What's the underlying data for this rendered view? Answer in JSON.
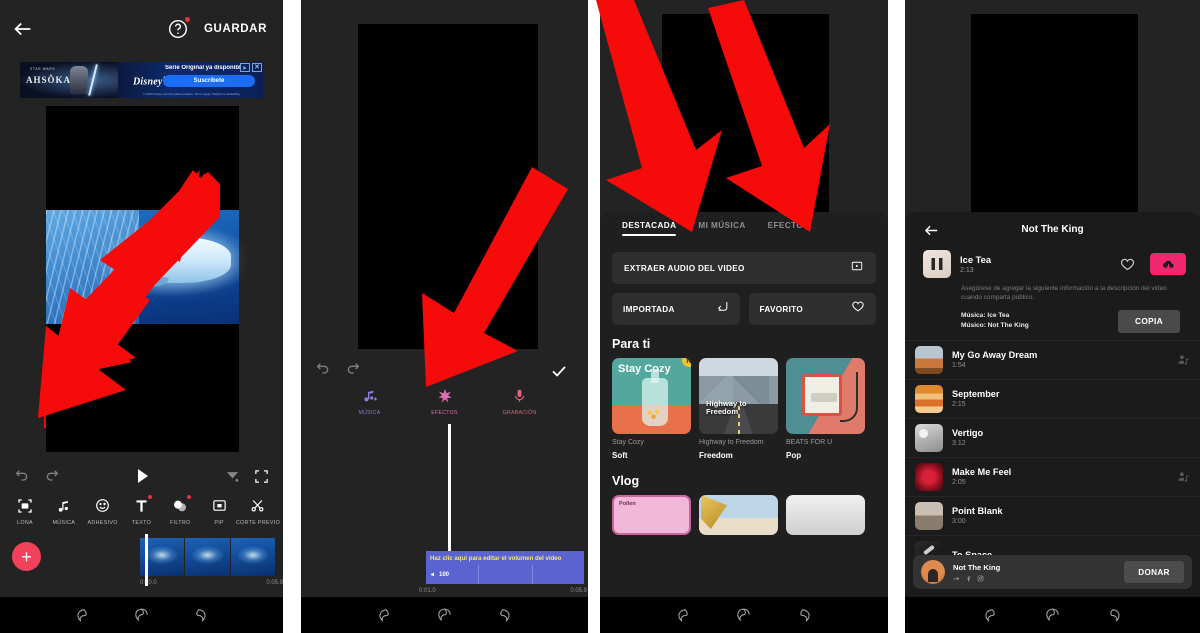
{
  "panel1": {
    "header": {
      "back_icon": "arrow-left-icon",
      "help_icon": "help-circle-icon",
      "save_label": "GUARDAR"
    },
    "ad": {
      "pre_title": "STAR WARS",
      "title": "AHSÔKA",
      "brand": "Disney",
      "brand_plus": "+",
      "headline": "Serie Original ya disponible",
      "cta": "Suscríbete",
      "fine_print": "© 2023 Disney and its related entities. Terms apply. Subject to availability.",
      "ad_badge": "ad-choices-icon",
      "close": "✕"
    },
    "controls": {
      "undo_icon": "undo-icon",
      "redo_icon": "redo-icon",
      "play_icon": "play-icon",
      "ratio_icon": "ratio-icon",
      "expand_icon": "expand-icon"
    },
    "tools": [
      {
        "label": "LONA",
        "icon": "canvas-icon",
        "badge": false
      },
      {
        "label": "MÚSICA",
        "icon": "music-note-icon",
        "badge": false
      },
      {
        "label": "ADHESIVO",
        "icon": "sticker-smiley-icon",
        "badge": false
      },
      {
        "label": "TEXTO",
        "icon": "text-icon",
        "badge": true
      },
      {
        "label": "FILTRO",
        "icon": "filter-drops-icon",
        "badge": true
      },
      {
        "label": "PIP",
        "icon": "pip-icon",
        "badge": false
      },
      {
        "label": "CORTE PREVIO",
        "icon": "scissors-icon",
        "badge": false
      }
    ],
    "add_button": "+",
    "timeline": {
      "start": "0:00.0",
      "end": "0:05.9",
      "clips": 3
    }
  },
  "panel2": {
    "controls": {
      "undo_icon": "undo-icon",
      "redo_icon": "redo-icon",
      "play_icon": "play-icon",
      "confirm_icon": "check-icon"
    },
    "audio_tools": [
      {
        "label": "MÚSICA",
        "icon": "music-add-icon",
        "color": "#8d7fd8"
      },
      {
        "label": "EFECTOS",
        "icon": "sparkle-icon",
        "color": "#d96fb0"
      },
      {
        "label": "GRABACIÓN",
        "icon": "microphone-icon",
        "color": "#e0637a"
      }
    ],
    "tooltip": "Haz clic aquí para editar el volumen del vídeo",
    "clip_volume": "100",
    "timeline": {
      "start": "0:01.0",
      "end": "0:05.9"
    }
  },
  "panel3": {
    "tabs": [
      {
        "label": "DESTACADA",
        "active": true
      },
      {
        "label": "MI MÚSICA",
        "active": false
      },
      {
        "label": "EFECTOS",
        "active": false
      }
    ],
    "extract_label": "EXTRAER AUDIO DEL VIDEO",
    "extract_icon": "video-play-box-icon",
    "imported_label": "IMPORTADA",
    "imported_icon": "import-arrow-icon",
    "favorite_label": "FAVORITO",
    "favorite_icon": "heart-icon",
    "section_para_ti": "Para ti",
    "new_badge": "N",
    "cards": [
      {
        "name": "Stay Cozy",
        "genre": "Soft",
        "art_title": "Stay Cozy",
        "new": true
      },
      {
        "name": "Highway to Freedom",
        "genre": "Freedom",
        "art_title": "Highway to Freedom",
        "new": false
      },
      {
        "name": "BEATS FOR U",
        "genre": "Pop",
        "art_title": "",
        "new": false
      }
    ],
    "section_vlog": "Vlog",
    "vlog_cards": [
      {
        "title": "Pollen"
      },
      {
        "title": ""
      },
      {
        "title": ""
      }
    ]
  },
  "panel4": {
    "back_icon": "arrow-left-icon",
    "title": "Not The King",
    "now_playing": {
      "name": "Ice Tea",
      "duration": "2:13",
      "state_icon": "pause-icon",
      "favorite_icon": "heart-icon",
      "download_icon": "download-cloud-icon",
      "download_color": "#f0266e"
    },
    "notice": "Asegúrese de agregar la siguiente información a la descripción del video cuando comparta público.",
    "credit_music": "Música: Ice Tea",
    "credit_artist": "Músico: Not The King",
    "copy_label": "COPIA",
    "tracks": [
      {
        "name": "My Go Away Dream",
        "duration": "1:54",
        "has_artist_icon": true
      },
      {
        "name": "September",
        "duration": "2:15",
        "has_artist_icon": false
      },
      {
        "name": "Vertigo",
        "duration": "3:12",
        "has_artist_icon": false
      },
      {
        "name": "Make Me Feel",
        "duration": "2:05",
        "has_artist_icon": true
      },
      {
        "name": "Point Blank",
        "duration": "3:00",
        "has_artist_icon": false
      },
      {
        "name": "To Space",
        "duration": "",
        "has_artist_icon": false
      }
    ],
    "donate_bar": {
      "artist": "Not The King",
      "socials": [
        "soundcloud-icon",
        "facebook-icon",
        "instagram-icon"
      ],
      "button_label": "DONAR"
    }
  },
  "navbar": {
    "back_icon": "nav-back-icon",
    "home_icon": "nav-home-icon",
    "recents_icon": "nav-recents-icon"
  },
  "annotations": {
    "arrow_color": "#f60a0a",
    "count": 5
  }
}
